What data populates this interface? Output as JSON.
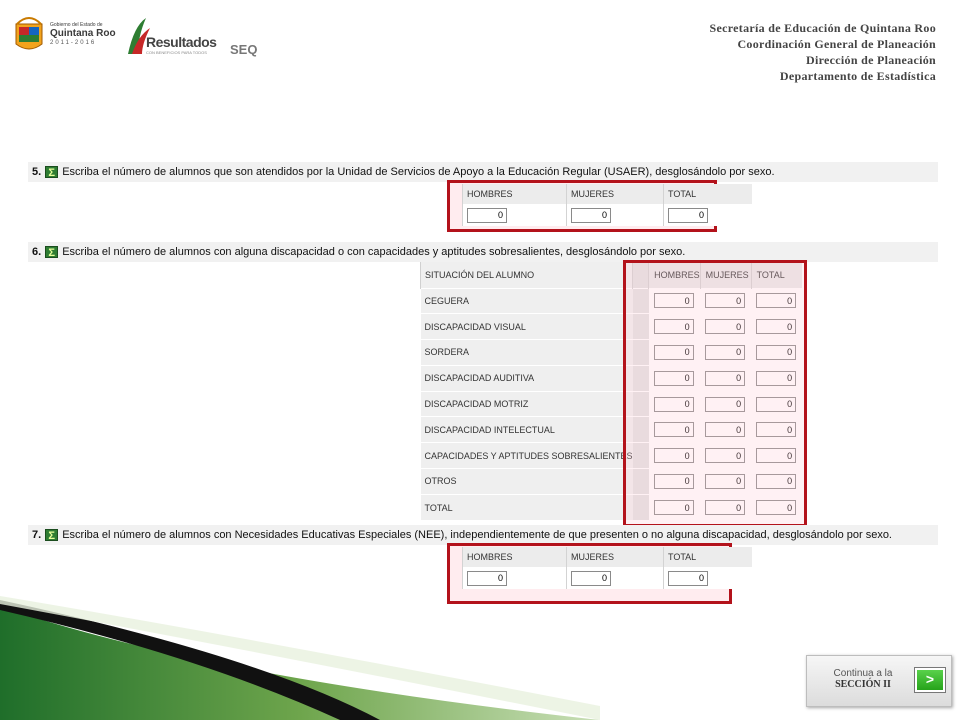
{
  "header": {
    "gob_small": "Gobierno del Estado de",
    "gob_big": "Quintana Roo",
    "gob_years": "2011-2016",
    "res_title": "Resultados",
    "res_sub": "CON BENEFICIOS PARA TODOS",
    "seq": "SEQ",
    "lines": [
      "Secretaría de Educación de Quintana Roo",
      "Coordinación General de Planeación",
      "Dirección de Planeación",
      "Departamento de Estadística"
    ]
  },
  "q5": {
    "num": "5.",
    "icon": "sigma-icon",
    "text": "Escriba el número de alumnos que son atendidos por la Unidad de Servicios de Apoyo a la Educación Regular (USAER), desglosándolo por sexo.",
    "headers": [
      "HOMBRES",
      "MUJERES",
      "TOTAL"
    ],
    "values": [
      "0",
      "0",
      "0"
    ]
  },
  "q6": {
    "num": "6.",
    "icon": "sigma-icon",
    "text": "Escriba el número de alumnos con alguna discapacidad o con capacidades y aptitudes sobresalientes, desglosándolo por sexo.",
    "headers": [
      "SITUACIÓN DEL ALUMNO",
      "HOMBRES",
      "MUJERES",
      "TOTAL"
    ],
    "rows": [
      {
        "label": "CEGUERA",
        "values": [
          "0",
          "0",
          "0"
        ]
      },
      {
        "label": "DISCAPACIDAD VISUAL",
        "values": [
          "0",
          "0",
          "0"
        ]
      },
      {
        "label": "SORDERA",
        "values": [
          "0",
          "0",
          "0"
        ]
      },
      {
        "label": "DISCAPACIDAD AUDITIVA",
        "values": [
          "0",
          "0",
          "0"
        ]
      },
      {
        "label": "DISCAPACIDAD MOTRIZ",
        "values": [
          "0",
          "0",
          "0"
        ]
      },
      {
        "label": "DISCAPACIDAD INTELECTUAL",
        "values": [
          "0",
          "0",
          "0"
        ]
      },
      {
        "label": "CAPACIDADES Y APTITUDES SOBRESALIENTES",
        "values": [
          "0",
          "0",
          "0"
        ]
      },
      {
        "label": "OTROS",
        "values": [
          "0",
          "0",
          "0"
        ]
      },
      {
        "label": "TOTAL",
        "values": [
          "0",
          "0",
          "0"
        ]
      }
    ]
  },
  "q7": {
    "num": "7.",
    "icon": "sigma-icon",
    "text": "Escriba el número de alumnos con Necesidades Educativas Especiales (NEE), independientemente de que presenten o no alguna discapacidad, desglosándolo por sexo.",
    "headers": [
      "HOMBRES",
      "MUJERES",
      "TOTAL"
    ],
    "values": [
      "0",
      "0",
      "0"
    ]
  },
  "continue": {
    "line1": "Continua a la",
    "line2": "SECCIÓN II",
    "button": ">"
  },
  "colors": {
    "highlight": "#b3121b",
    "accent_green": "#2e7d32"
  }
}
